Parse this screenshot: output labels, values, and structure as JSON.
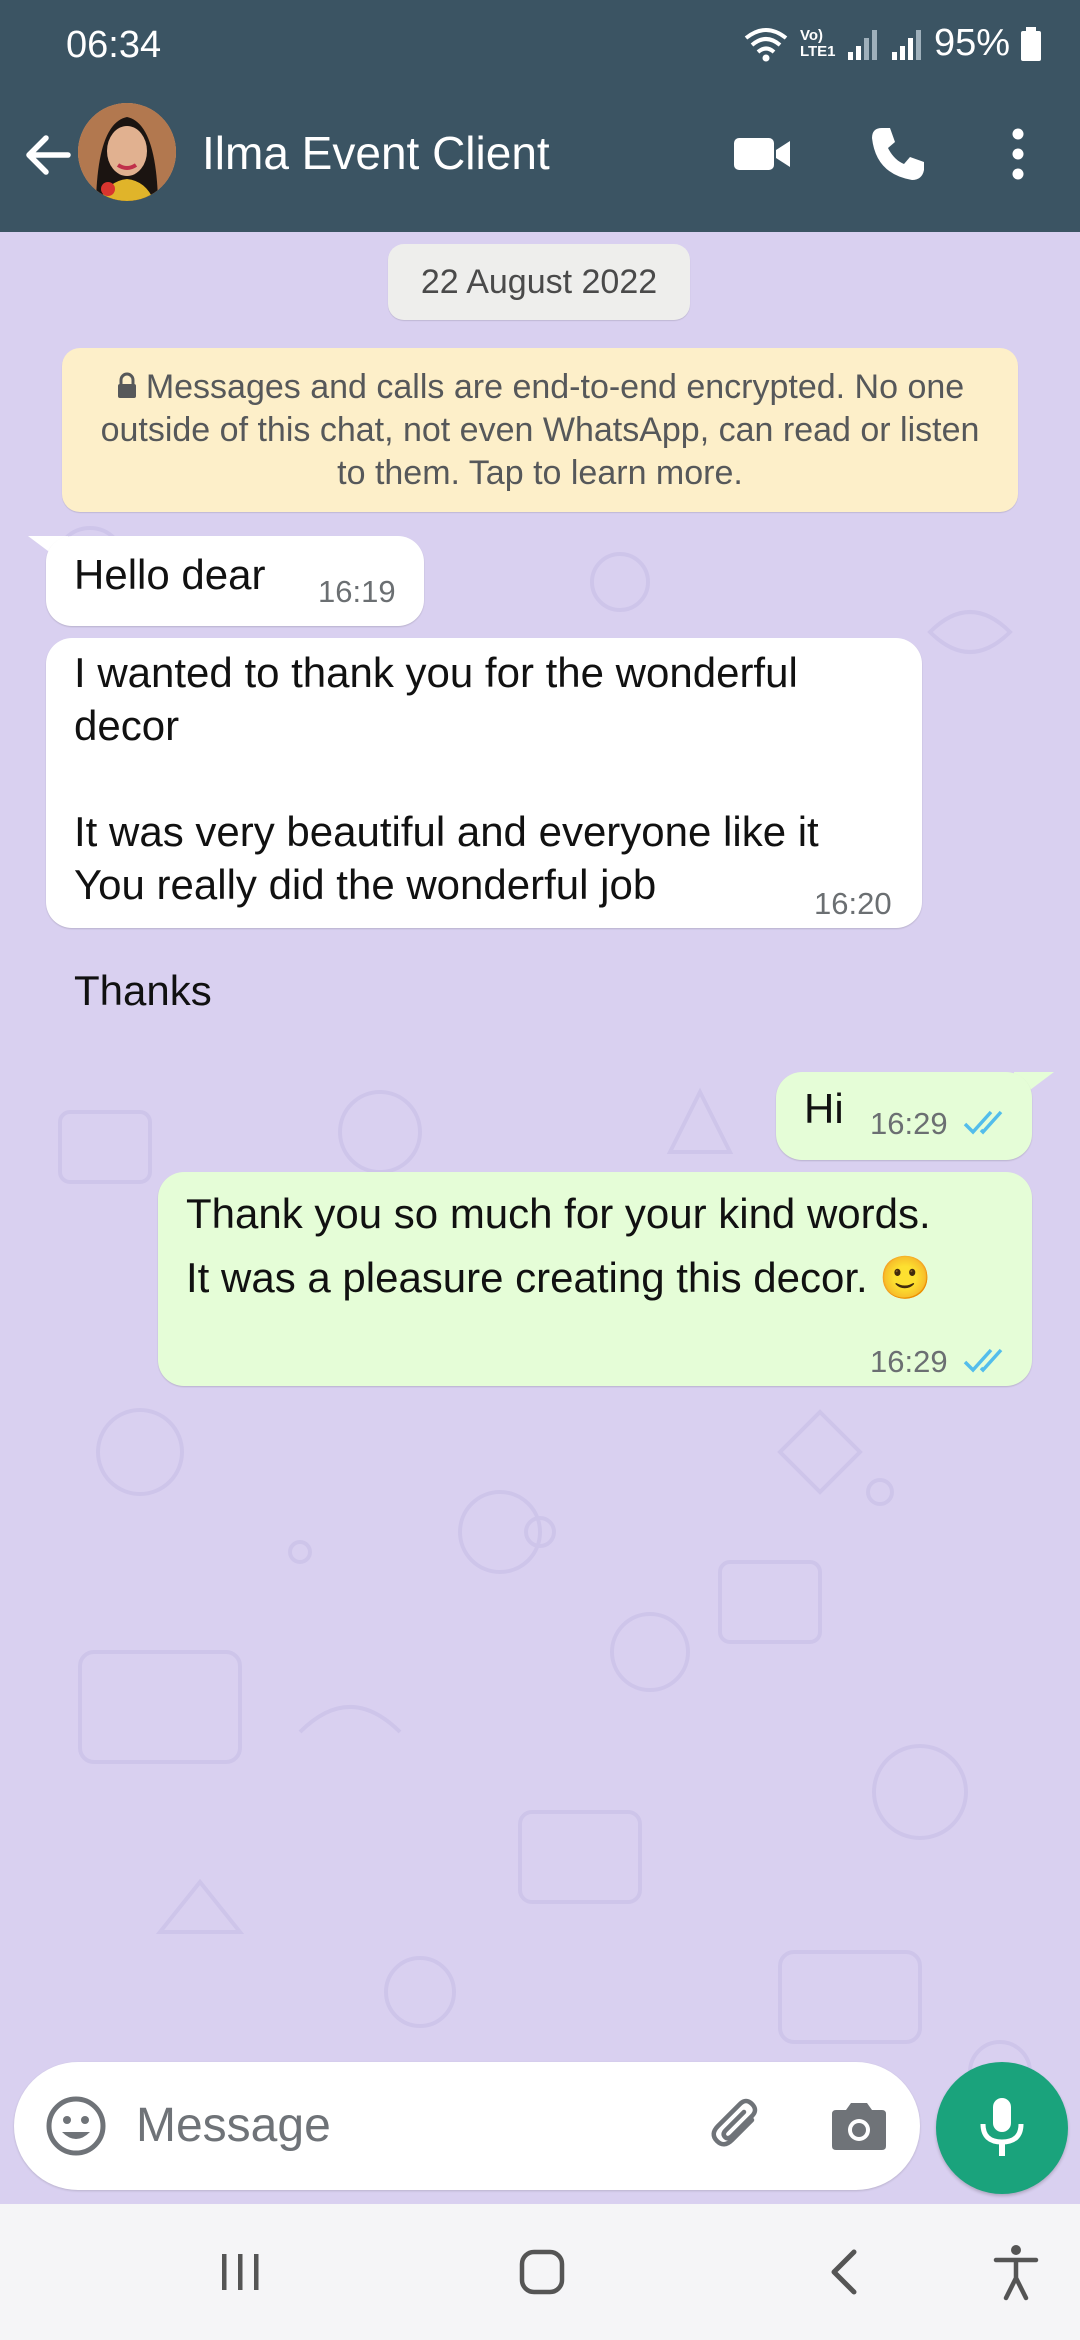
{
  "status_bar": {
    "time": "06:34",
    "network": "Vo) LTE1",
    "battery": "95%"
  },
  "header": {
    "contact_name": "Ilma Event Client",
    "icons": [
      "back-arrow-icon",
      "avatar",
      "video-call-icon",
      "phone-icon",
      "more-options-icon"
    ]
  },
  "chat": {
    "date_chip": "22 August 2022",
    "encryption_notice": "Messages and calls are end-to-end encrypted. No one outside of this chat, not even WhatsApp, can read or listen to them. Tap to learn more.",
    "messages": [
      {
        "direction": "incoming",
        "text": "Hello dear",
        "time": "16:19"
      },
      {
        "direction": "incoming",
        "text": "I wanted to thank you for the wonderful decor\n\nIt was very beautiful and everyone like it\nYou really did the wonderful job\n\nThanks",
        "time": "16:20"
      },
      {
        "direction": "outgoing",
        "text": "Hi",
        "time": "16:29",
        "read": true
      },
      {
        "direction": "outgoing",
        "text": "Thank you so much for your kind words.\nIt was a pleasure creating this decor. 🙂",
        "time": "16:29",
        "read": true
      }
    ]
  },
  "composer": {
    "placeholder": "Message",
    "icons": [
      "emoji-icon",
      "attach-icon",
      "camera-icon",
      "mic-icon"
    ]
  },
  "colors": {
    "header_bg": "#3b5463",
    "chat_bg": "#d9d0f0",
    "outgoing_bubble": "#e5fdd7",
    "incoming_bubble": "#ffffff",
    "encryption_bg": "#fdefc9",
    "read_ticks": "#53bdeb",
    "mic_button": "#1aa37c"
  }
}
